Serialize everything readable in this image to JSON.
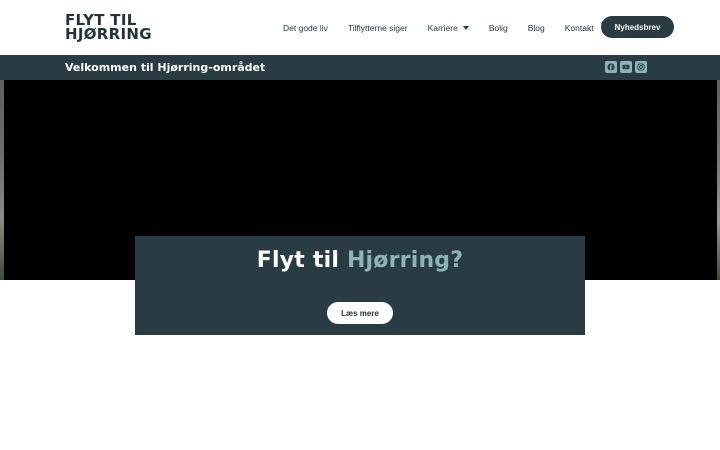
{
  "header": {
    "logo": {
      "line1": "FLYT TIL",
      "line2": "HJØRRING"
    },
    "nav": [
      {
        "label": "Det gode liv",
        "has_dropdown": false
      },
      {
        "label": "Tilflytterne siger",
        "has_dropdown": false
      },
      {
        "label": "Karriere",
        "has_dropdown": true
      },
      {
        "label": "Bolig",
        "has_dropdown": false
      },
      {
        "label": "Blog",
        "has_dropdown": false
      },
      {
        "label": "Kontakt",
        "has_dropdown": false
      }
    ],
    "cta_label": "Nyhedsbrev"
  },
  "bar": {
    "title": "Velkommen til Hjørring-området",
    "social_icons": [
      "facebook-icon",
      "youtube-icon",
      "instagram-icon"
    ]
  },
  "hero": {
    "title_part1": "Flyt til ",
    "title_accent": "Hjørring?",
    "button_label": "Læs mere"
  },
  "colors": {
    "dark_teal": "#2a3c43",
    "accent": "#8cb6b6",
    "white": "#ffffff"
  }
}
